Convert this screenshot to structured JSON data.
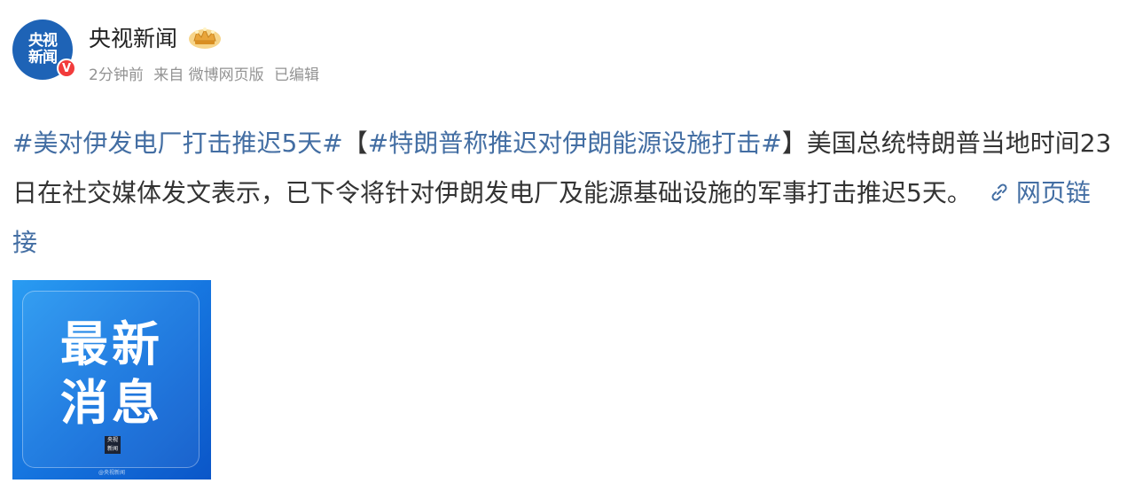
{
  "post": {
    "author": {
      "avatar_text": "央视\n新闻",
      "verified_mark": "V",
      "name": "央视新闻"
    },
    "meta": {
      "time": "2分钟前",
      "source": "来自 微博网页版",
      "edited": "已编辑"
    },
    "content": {
      "hashtag_1": "#美对伊发电厂打击推迟5天#",
      "bracket_open": "【",
      "hashtag_2": "#特朗普称推迟对伊朗能源设施打击#",
      "bracket_close": "】",
      "body": "美国总统特朗普当地时间23日在社交媒体发文表示，已下令将针对伊朗发电厂及能源基础设施的军事打击推迟5天。",
      "link_label": "网页链接",
      "link_icon": "link-icon"
    },
    "image": {
      "title": "最新\n消息",
      "logo_text": "央视\n新闻",
      "footer": "@央视新闻"
    }
  },
  "colors": {
    "link": "#436ea3",
    "text": "#333333",
    "meta": "#939393",
    "avatar_bg": "#1e63b6",
    "verified": "#f23b3b",
    "image_bg": "#1676e0"
  }
}
